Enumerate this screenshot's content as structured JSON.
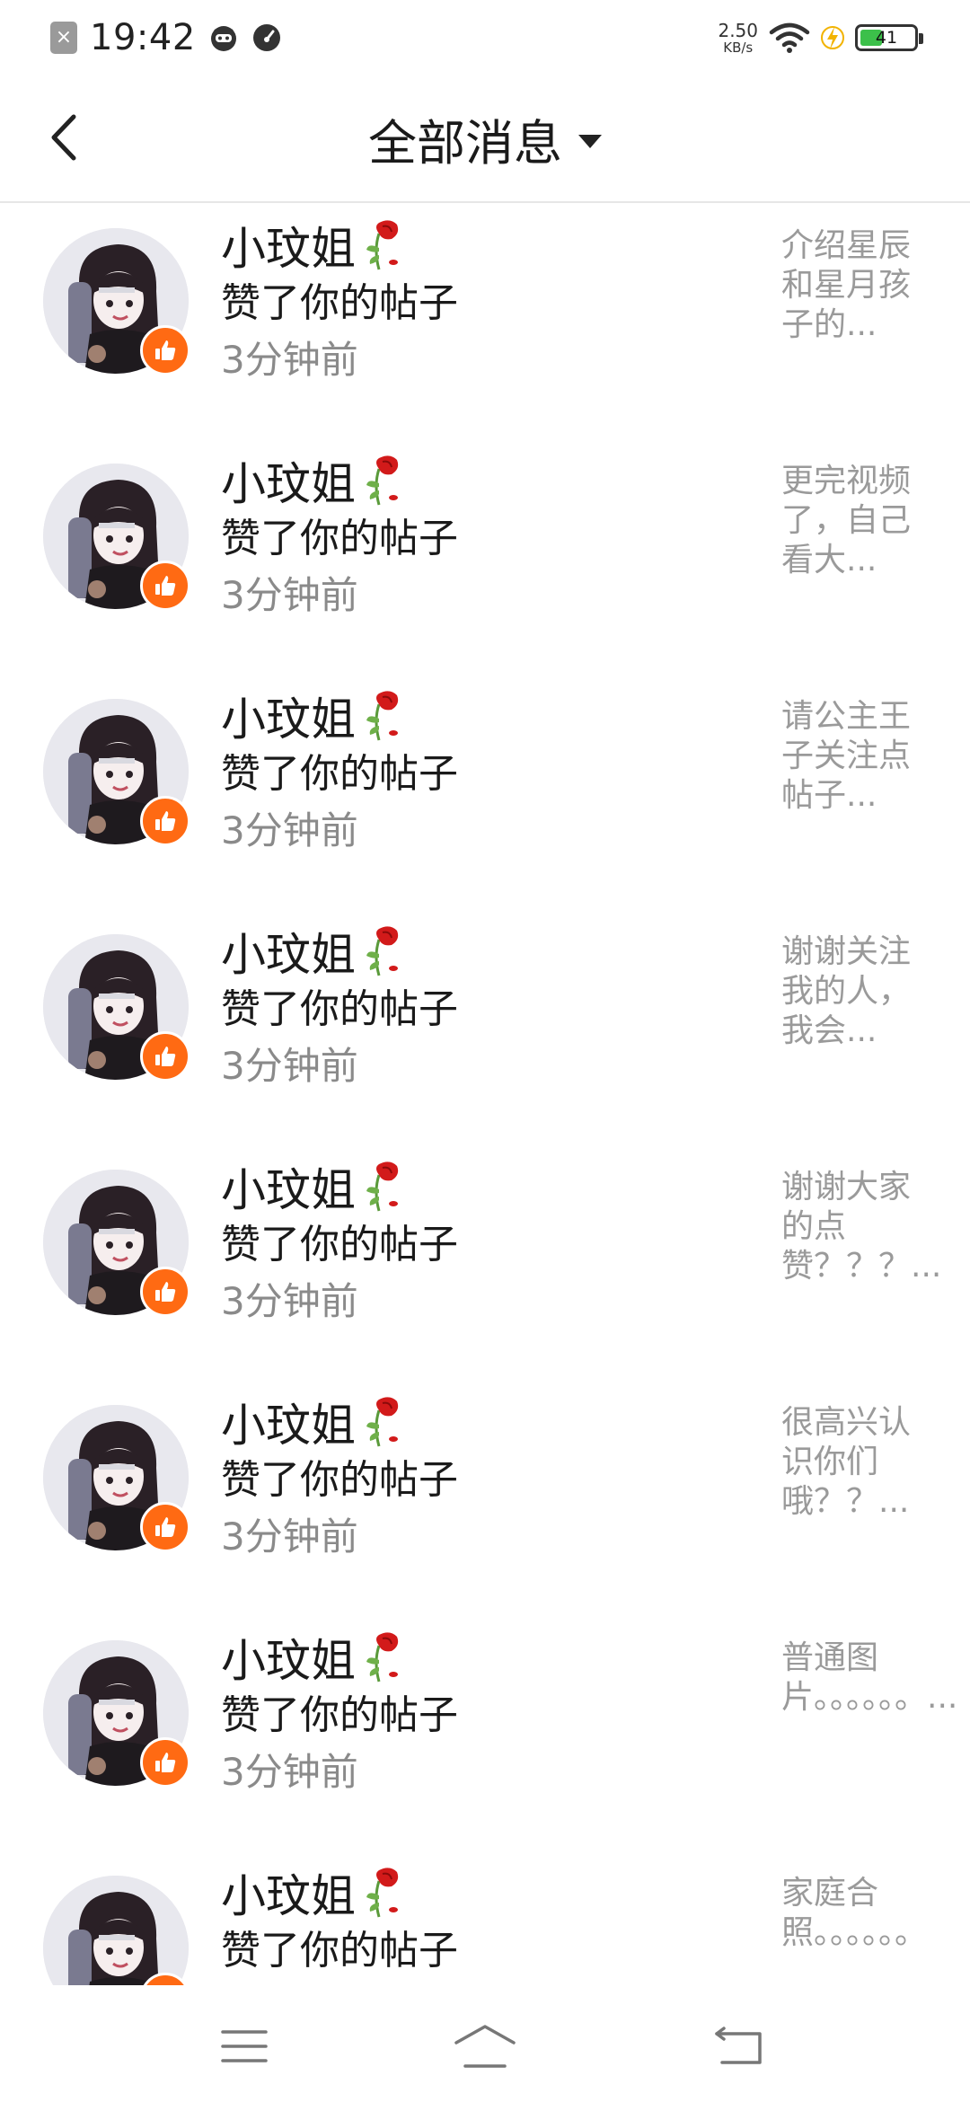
{
  "status_bar": {
    "time": "19:42",
    "close_glyph": "×",
    "speed_value": "2.50",
    "speed_unit": "KB/s",
    "battery_level": "41",
    "battery_fraction": 0.41,
    "icons": [
      "notification-close-icon",
      "bot-icon",
      "gauge-icon",
      "wifi-icon",
      "charging-icon",
      "battery-icon"
    ]
  },
  "header": {
    "title": "全部消息",
    "back_icon": "back-chevron-icon",
    "dropdown_icon": "caret-down-icon"
  },
  "notifications": [
    {
      "name": "小玟姐",
      "action": "赞了你的帖子",
      "time": "3分钟前",
      "preview": "介绍星辰和星月孩子的..."
    },
    {
      "name": "小玟姐",
      "action": "赞了你的帖子",
      "time": "3分钟前",
      "preview": "更完视频了，自己看大..."
    },
    {
      "name": "小玟姐",
      "action": "赞了你的帖子",
      "time": "3分钟前",
      "preview": "请公主王子关注点帖子..."
    },
    {
      "name": "小玟姐",
      "action": "赞了你的帖子",
      "time": "3分钟前",
      "preview": "谢谢关注我的人，我会..."
    },
    {
      "name": "小玟姐",
      "action": "赞了你的帖子",
      "time": "3分钟前",
      "preview": "谢谢大家的点赞？？？..."
    },
    {
      "name": "小玟姐",
      "action": "赞了你的帖子",
      "time": "3分钟前",
      "preview": "很高兴认识你们哦？？..."
    },
    {
      "name": "小玟姐",
      "action": "赞了你的帖子",
      "time": "3分钟前",
      "preview": "普通图片。。。。。。..."
    },
    {
      "name": "小玟姐",
      "action": "赞了你的帖子",
      "time": "",
      "preview": "家庭合照。。。。。。"
    }
  ],
  "nav_bar": {
    "icons": [
      "menu-icon",
      "home-icon",
      "back-icon"
    ]
  },
  "colors": {
    "like_badge": "#ff6a13",
    "battery_fill": "#3cc04a",
    "secondary_text": "#8a8a8a"
  }
}
